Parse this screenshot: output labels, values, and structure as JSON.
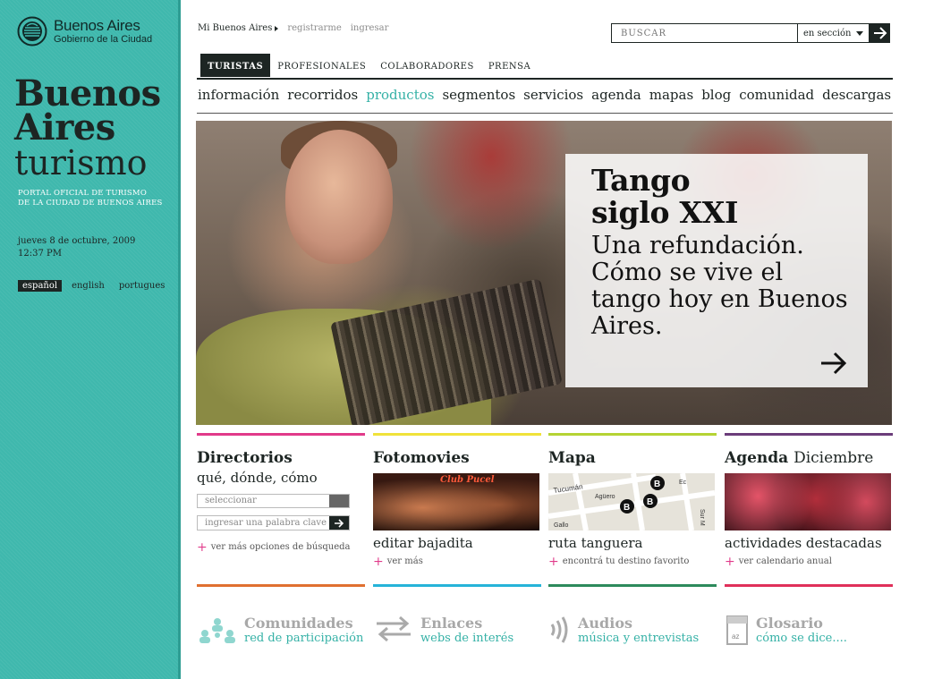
{
  "government": {
    "name_line1": "Buenos Aires",
    "name_line2": "Gobierno de la Ciudad"
  },
  "brand": {
    "line1": "Buenos",
    "line2": "Aires",
    "line3": "turismo"
  },
  "portal": {
    "line1": "PORTAL OFICIAL DE TURISMO",
    "line2": "DE LA CIUDAD DE BUENOS AIRES"
  },
  "date": {
    "day": "jueves 8 de octubre, 2009",
    "time": "12:37 PM"
  },
  "languages": [
    "español",
    "english",
    "portugues"
  ],
  "top_links": {
    "my": "Mi Buenos Aires",
    "register": "registrarme",
    "login": "ingresar"
  },
  "search": {
    "placeholder": "BUSCAR",
    "scope": "en sección"
  },
  "tabs": [
    "TURISTAS",
    "PROFESIONALES",
    "COLABORADORES",
    "PRENSA"
  ],
  "nav": [
    "información",
    "recorridos",
    "productos",
    "segmentos",
    "servicios",
    "agenda",
    "mapas",
    "blog",
    "comunidad",
    "descargas"
  ],
  "hero": {
    "title_line1": "Tango",
    "title_line2": "siglo XXI",
    "subtitle": "Una refundación. Cómo se vive el tango hoy en Buenos Aires."
  },
  "columns": {
    "directorios": {
      "title": "Directorios",
      "subtitle": "qué, dónde, cómo",
      "select_placeholder": "seleccionar",
      "keyword_placeholder": "ingresar una palabra clave",
      "more": "ver más opciones de búsqueda",
      "color": "#e13a8a"
    },
    "fotomovies": {
      "title": "Fotomovies",
      "caption": "editar bajadita",
      "more": "ver más",
      "thumb_sign": "Club Pucel",
      "color": "#f0e23a"
    },
    "mapa": {
      "title": "Mapa",
      "caption": "ruta tanguera",
      "more": "encontrá tu destino favorito",
      "color": "#b5d334",
      "streets": [
        "Tucumán",
        "Agüero",
        "Gallo",
        "Ec",
        "Sur M",
        "Pringle",
        "tuluongue Sur M"
      ]
    },
    "agenda": {
      "title": "Agenda",
      "title_light": "Diciembre",
      "caption": "actividades destacadas",
      "more": "ver calendario anual",
      "color": "#6b3d7a"
    }
  },
  "bottom": [
    {
      "title": "Comunidades",
      "subtitle": "red de participación",
      "icon": "community-icon",
      "color": "#e07030"
    },
    {
      "title": "Enlaces",
      "subtitle": "webs de interés",
      "icon": "links-icon",
      "color": "#26b3d8"
    },
    {
      "title": "Audios",
      "subtitle": "música y entrevistas",
      "icon": "audio-icon",
      "color": "#2d8a5c"
    },
    {
      "title": "Glosario",
      "subtitle": "cómo se dice....",
      "icon": "glossary-icon",
      "color": "#e0305a",
      "icon_text": "az"
    }
  ]
}
